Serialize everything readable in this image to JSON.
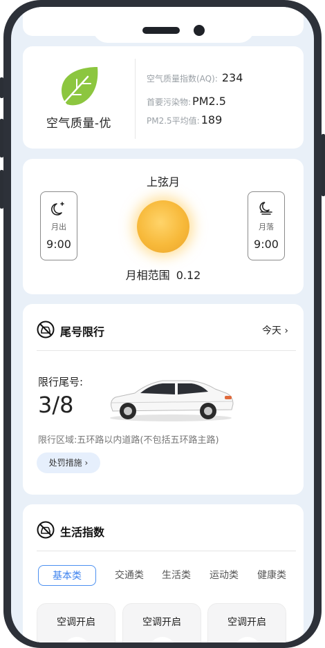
{
  "colors": {
    "accent": "#4a8ff0",
    "leaf": "#8cc63f",
    "sun": "#f7b93a",
    "screen_bg": "#e9f0f8"
  },
  "air_quality": {
    "icon": "leaf-icon",
    "title": "空气质量-优",
    "aqi_label": "空气质量指数(AQ):",
    "aqi_value": "234",
    "pollutant_label": "首要污染物:",
    "pollutant_value": "PM2.5",
    "pm25_label": "PM2.5平均值:",
    "pm25_value": "189"
  },
  "moon": {
    "title": "上弦月",
    "rise_icon": "moon-star-icon",
    "rise_label": "月出",
    "rise_time": "9:00",
    "set_icon": "moonset-icon",
    "set_label": "月落",
    "set_time": "9:00",
    "phase_label": "月相范围",
    "phase_value": "0.12"
  },
  "restriction": {
    "icon": "no-car-icon",
    "title": "尾号限行",
    "link_label": "今天",
    "number_label": "限行尾号:",
    "numbers": "3/8",
    "area_text": "限行区域:五环路以内道路(不包括五环路主路)",
    "penalty_button": "处罚措施"
  },
  "life_index": {
    "icon": "no-car-icon",
    "title": "生活指数",
    "tabs": [
      "基本类",
      "交通类",
      "生活类",
      "运动类",
      "健康类"
    ],
    "active_tab": 0,
    "tiles": [
      "空调开启",
      "空调开启",
      "空调开启"
    ]
  }
}
